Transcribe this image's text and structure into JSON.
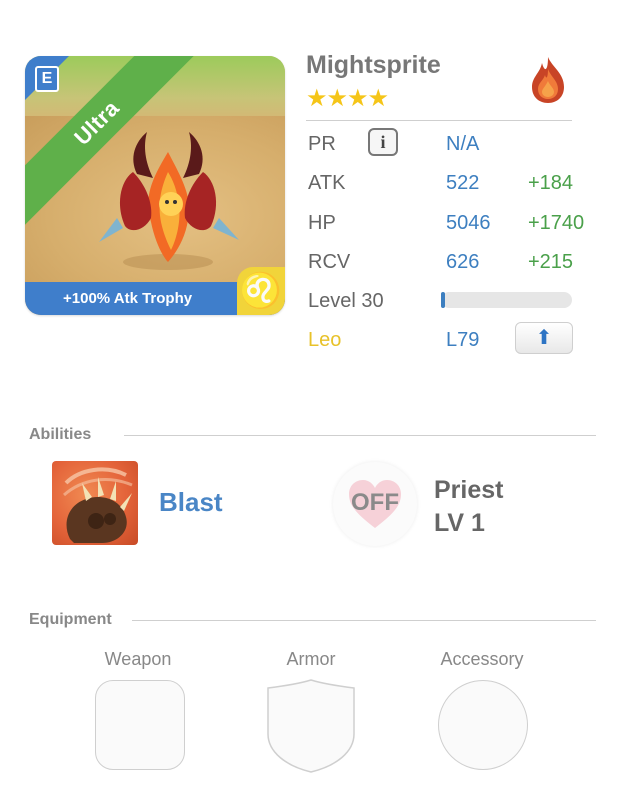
{
  "card": {
    "rarity": "Ultra",
    "edit_icon_glyph": "E",
    "trophy_text": "+100% Atk Trophy",
    "zodiac_glyph": "♌",
    "colors": {
      "ribbon": "#5fb04a",
      "bar": "#3f7ecb",
      "zodiac": "#f1d43a"
    }
  },
  "monster": {
    "name": "Mightsprite",
    "stars": "★★★★",
    "star_count": 4,
    "element_icon": "fire-element-icon"
  },
  "stats": {
    "pr": {
      "label": "PR",
      "value": "N/A",
      "info_glyph": "i"
    },
    "atk": {
      "label": "ATK",
      "value": "522",
      "bonus": "+184"
    },
    "hp": {
      "label": "HP",
      "value": "5046",
      "bonus": "+1740"
    },
    "rcv": {
      "label": "RCV",
      "value": "626",
      "bonus": "+215"
    },
    "level": {
      "label": "Level 30",
      "progress": 0.02
    },
    "sign": {
      "label": "Leo",
      "value": "L79",
      "button_icon": "arrow-up-icon",
      "button_glyph": "⬆"
    }
  },
  "abilities": {
    "title": "Abilities",
    "skill_name": "Blast",
    "skill_icon": "claw-skill-icon",
    "toggle_label": "OFF",
    "class_name": "Priest",
    "class_level": "LV 1"
  },
  "equipment": {
    "title": "Equipment",
    "slots": [
      {
        "label": "Weapon"
      },
      {
        "label": "Armor"
      },
      {
        "label": "Accessory"
      }
    ]
  }
}
